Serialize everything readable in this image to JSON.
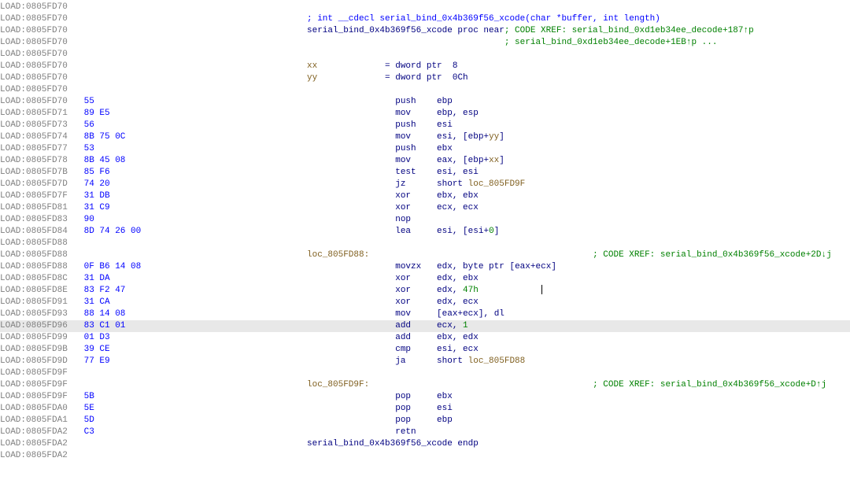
{
  "highlight_index": 27,
  "cols": {
    "label": 390,
    "mnem": 510
  },
  "rows": [
    {
      "addr": "LOAD:0805FD70",
      "bytes": "",
      "kind": "blank"
    },
    {
      "addr": "LOAD:0805FD70",
      "bytes": "",
      "kind": "cdecl",
      "text": "; int __cdecl serial_bind_0x4b369f56_xcode(char *buffer, int length)"
    },
    {
      "addr": "LOAD:0805FD70",
      "bytes": "",
      "kind": "prochdr",
      "proc": "serial_bind_0x4b369f56_xcode proc near",
      "x1": "; CODE XREF: serial_bind_0xd1eb34ee_decode+187↑p"
    },
    {
      "addr": "LOAD:0805FD70",
      "bytes": "",
      "kind": "xrefcont",
      "text": "; serial_bind_0xd1eb34ee_decode+1EB↑p ..."
    },
    {
      "addr": "LOAD:0805FD70",
      "bytes": "",
      "kind": "blank"
    },
    {
      "addr": "LOAD:0805FD70",
      "bytes": "",
      "kind": "vardecl",
      "name": "xx",
      "eq": "= dword ptr  8"
    },
    {
      "addr": "LOAD:0805FD70",
      "bytes": "",
      "kind": "vardecl",
      "name": "yy",
      "eq": "= dword ptr  0Ch"
    },
    {
      "addr": "LOAD:0805FD70",
      "bytes": "",
      "kind": "blank"
    },
    {
      "addr": "LOAD:0805FD70",
      "bytes": "55",
      "kind": "ins",
      "mnem": "push",
      "args": [
        {
          "t": "reg",
          "v": "ebp"
        }
      ]
    },
    {
      "addr": "LOAD:0805FD71",
      "bytes": "89 E5",
      "kind": "ins",
      "mnem": "mov",
      "args": [
        {
          "t": "reg",
          "v": "ebp"
        },
        {
          "t": "reg",
          "v": "esp"
        }
      ]
    },
    {
      "addr": "LOAD:0805FD73",
      "bytes": "56",
      "kind": "ins",
      "mnem": "push",
      "args": [
        {
          "t": "reg",
          "v": "esi"
        }
      ]
    },
    {
      "addr": "LOAD:0805FD74",
      "bytes": "8B 75 0C",
      "kind": "ins",
      "mnem": "mov",
      "args": [
        {
          "t": "reg",
          "v": "esi"
        },
        {
          "t": "mix",
          "open": "[",
          "a": "ebp",
          "plus": "+",
          "b": "yy",
          "close": "]"
        }
      ]
    },
    {
      "addr": "LOAD:0805FD77",
      "bytes": "53",
      "kind": "ins",
      "mnem": "push",
      "args": [
        {
          "t": "reg",
          "v": "ebx"
        }
      ]
    },
    {
      "addr": "LOAD:0805FD78",
      "bytes": "8B 45 08",
      "kind": "ins",
      "mnem": "mov",
      "args": [
        {
          "t": "reg",
          "v": "eax"
        },
        {
          "t": "mix",
          "open": "[",
          "a": "ebp",
          "plus": "+",
          "b": "xx",
          "close": "]"
        }
      ]
    },
    {
      "addr": "LOAD:0805FD7B",
      "bytes": "85 F6",
      "kind": "ins",
      "mnem": "test",
      "args": [
        {
          "t": "reg",
          "v": "esi"
        },
        {
          "t": "reg",
          "v": "esi"
        }
      ]
    },
    {
      "addr": "LOAD:0805FD7D",
      "bytes": "74 20",
      "kind": "ins",
      "mnem": "jz",
      "args": [
        {
          "t": "kw",
          "v": "short"
        },
        {
          "t": "loc",
          "v": "loc_805FD9F"
        }
      ]
    },
    {
      "addr": "LOAD:0805FD7F",
      "bytes": "31 DB",
      "kind": "ins",
      "mnem": "xor",
      "args": [
        {
          "t": "reg",
          "v": "ebx"
        },
        {
          "t": "reg",
          "v": "ebx"
        }
      ]
    },
    {
      "addr": "LOAD:0805FD81",
      "bytes": "31 C9",
      "kind": "ins",
      "mnem": "xor",
      "args": [
        {
          "t": "reg",
          "v": "ecx"
        },
        {
          "t": "reg",
          "v": "ecx"
        }
      ]
    },
    {
      "addr": "LOAD:0805FD83",
      "bytes": "90",
      "kind": "ins",
      "mnem": "nop",
      "args": []
    },
    {
      "addr": "LOAD:0805FD84",
      "bytes": "8D 74 26 00",
      "kind": "ins",
      "mnem": "lea",
      "args": [
        {
          "t": "reg",
          "v": "esi"
        },
        {
          "t": "mix",
          "open": "[",
          "a": "esi",
          "plus": "+",
          "b": "0",
          "bnum": true,
          "close": "]"
        }
      ]
    },
    {
      "addr": "LOAD:0805FD88",
      "bytes": "",
      "kind": "blank"
    },
    {
      "addr": "LOAD:0805FD88",
      "bytes": "",
      "kind": "label",
      "name": "loc_805FD88:",
      "xref": "; CODE XREF: serial_bind_0x4b369f56_xcode+2D↓j"
    },
    {
      "addr": "LOAD:0805FD88",
      "bytes": "0F B6 14 08",
      "kind": "ins",
      "mnem": "movzx",
      "args": [
        {
          "t": "reg",
          "v": "edx"
        },
        {
          "t": "raw",
          "pre": "byte ptr ",
          "open": "[",
          "a": "eax",
          "plus": "+",
          "b": "ecx",
          "close": "]"
        }
      ]
    },
    {
      "addr": "LOAD:0805FD8C",
      "bytes": "31 DA",
      "kind": "ins",
      "mnem": "xor",
      "args": [
        {
          "t": "reg",
          "v": "edx"
        },
        {
          "t": "reg",
          "v": "ebx"
        }
      ]
    },
    {
      "addr": "LOAD:0805FD8E",
      "bytes": "83 F2 47",
      "kind": "ins",
      "mnem": "xor",
      "args": [
        {
          "t": "reg",
          "v": "edx"
        },
        {
          "t": "imm",
          "v": "47h"
        }
      ],
      "cursor": true
    },
    {
      "addr": "LOAD:0805FD91",
      "bytes": "31 CA",
      "kind": "ins",
      "mnem": "xor",
      "args": [
        {
          "t": "reg",
          "v": "edx"
        },
        {
          "t": "reg",
          "v": "ecx"
        }
      ]
    },
    {
      "addr": "LOAD:0805FD93",
      "bytes": "88 14 08",
      "kind": "ins",
      "mnem": "mov",
      "args": [
        {
          "t": "raw",
          "open": "[",
          "a": "eax",
          "plus": "+",
          "b": "ecx",
          "close": "]"
        },
        {
          "t": "reg",
          "v": "dl"
        }
      ]
    },
    {
      "addr": "LOAD:0805FD96",
      "bytes": "83 C1 01",
      "kind": "ins",
      "mnem": "add",
      "args": [
        {
          "t": "reg",
          "v": "ecx"
        },
        {
          "t": "imm",
          "v": "1"
        }
      ]
    },
    {
      "addr": "LOAD:0805FD99",
      "bytes": "01 D3",
      "kind": "ins",
      "mnem": "add",
      "args": [
        {
          "t": "reg",
          "v": "ebx"
        },
        {
          "t": "reg",
          "v": "edx"
        }
      ]
    },
    {
      "addr": "LOAD:0805FD9B",
      "bytes": "39 CE",
      "kind": "ins",
      "mnem": "cmp",
      "args": [
        {
          "t": "reg",
          "v": "esi"
        },
        {
          "t": "reg",
          "v": "ecx"
        }
      ]
    },
    {
      "addr": "LOAD:0805FD9D",
      "bytes": "77 E9",
      "kind": "ins",
      "mnem": "ja",
      "args": [
        {
          "t": "kw",
          "v": "short"
        },
        {
          "t": "loc",
          "v": "loc_805FD88"
        }
      ]
    },
    {
      "addr": "LOAD:0805FD9F",
      "bytes": "",
      "kind": "blank"
    },
    {
      "addr": "LOAD:0805FD9F",
      "bytes": "",
      "kind": "label",
      "name": "loc_805FD9F:",
      "xref": "; CODE XREF: serial_bind_0x4b369f56_xcode+D↑j"
    },
    {
      "addr": "LOAD:0805FD9F",
      "bytes": "5B",
      "kind": "ins",
      "mnem": "pop",
      "args": [
        {
          "t": "reg",
          "v": "ebx"
        }
      ]
    },
    {
      "addr": "LOAD:0805FDA0",
      "bytes": "5E",
      "kind": "ins",
      "mnem": "pop",
      "args": [
        {
          "t": "reg",
          "v": "esi"
        }
      ]
    },
    {
      "addr": "LOAD:0805FDA1",
      "bytes": "5D",
      "kind": "ins",
      "mnem": "pop",
      "args": [
        {
          "t": "reg",
          "v": "ebp"
        }
      ]
    },
    {
      "addr": "LOAD:0805FDA2",
      "bytes": "C3",
      "kind": "ins",
      "mnem": "retn",
      "args": []
    },
    {
      "addr": "LOAD:0805FDA2",
      "bytes": "",
      "kind": "endp",
      "text": "serial_bind_0x4b369f56_xcode endp"
    },
    {
      "addr": "LOAD:0805FDA2",
      "bytes": "",
      "kind": "blank"
    }
  ]
}
